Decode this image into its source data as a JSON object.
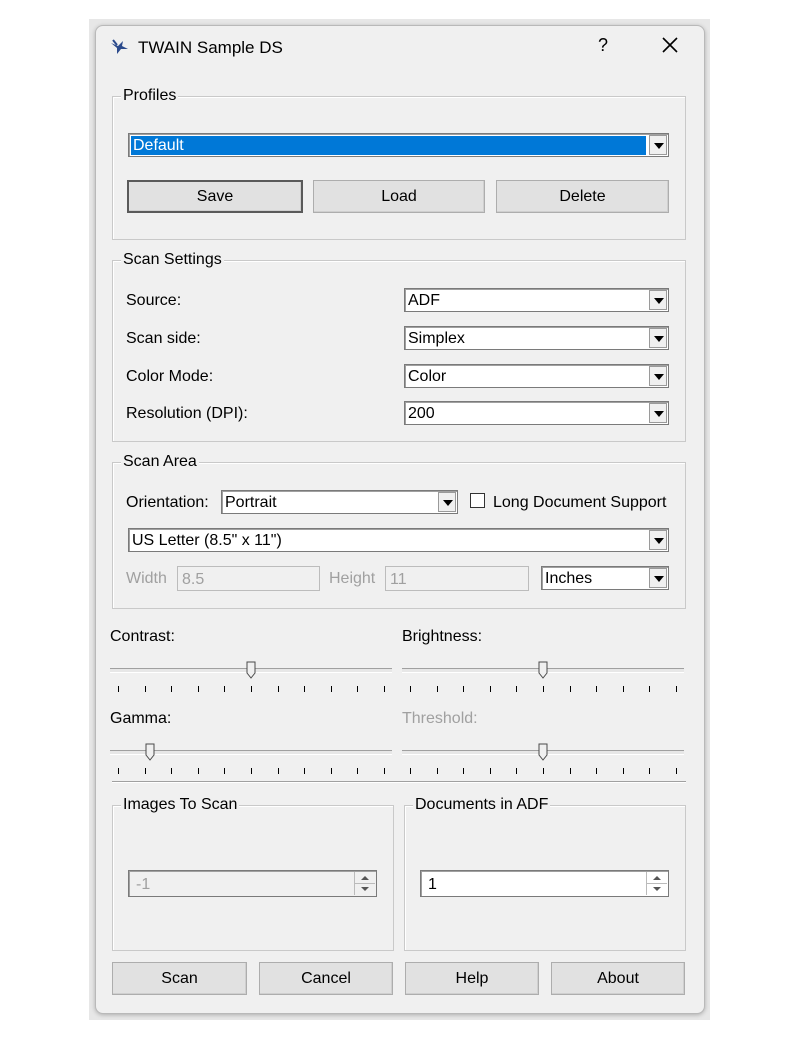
{
  "window": {
    "title": "TWAIN Sample DS",
    "help_label": "?",
    "close_label": "✕",
    "app_icon": "twain-bird-icon"
  },
  "profiles": {
    "legend": "Profiles",
    "selected": "Default",
    "save_label": "Save",
    "load_label": "Load",
    "delete_label": "Delete"
  },
  "scan_settings": {
    "legend": "Scan Settings",
    "source_label": "Source:",
    "source_value": "ADF",
    "scan_side_label": "Scan side:",
    "scan_side_value": "Simplex",
    "color_mode_label": "Color Mode:",
    "color_mode_value": "Color",
    "resolution_label": "Resolution (DPI):",
    "resolution_value": "200"
  },
  "scan_area": {
    "legend": "Scan Area",
    "orientation_label": "Orientation:",
    "orientation_value": "Portrait",
    "long_doc_label": "Long Document Support",
    "long_doc_checked": false,
    "paper_size": "US Letter (8.5\" x 11\")",
    "width_label": "Width",
    "width_value": "8.5",
    "height_label": "Height",
    "height_value": "11",
    "units_value": "Inches"
  },
  "sliders": {
    "contrast_label": "Contrast:",
    "contrast_position": 0.5,
    "brightness_label": "Brightness:",
    "brightness_position": 0.5,
    "gamma_label": "Gamma:",
    "gamma_position": 0.13,
    "threshold_label": "Threshold:",
    "threshold_position": 0.5,
    "threshold_disabled": true
  },
  "images_to_scan": {
    "legend": "Images To Scan",
    "value": "-1"
  },
  "documents_in_adf": {
    "legend": "Documents in ADF",
    "value": "1"
  },
  "footer": {
    "scan_label": "Scan",
    "cancel_label": "Cancel",
    "help_label": "Help",
    "about_label": "About"
  },
  "colors": {
    "selection": "#0078d7",
    "window_bg": "#f0f0f0",
    "disabled_text": "#a0a0a0"
  }
}
